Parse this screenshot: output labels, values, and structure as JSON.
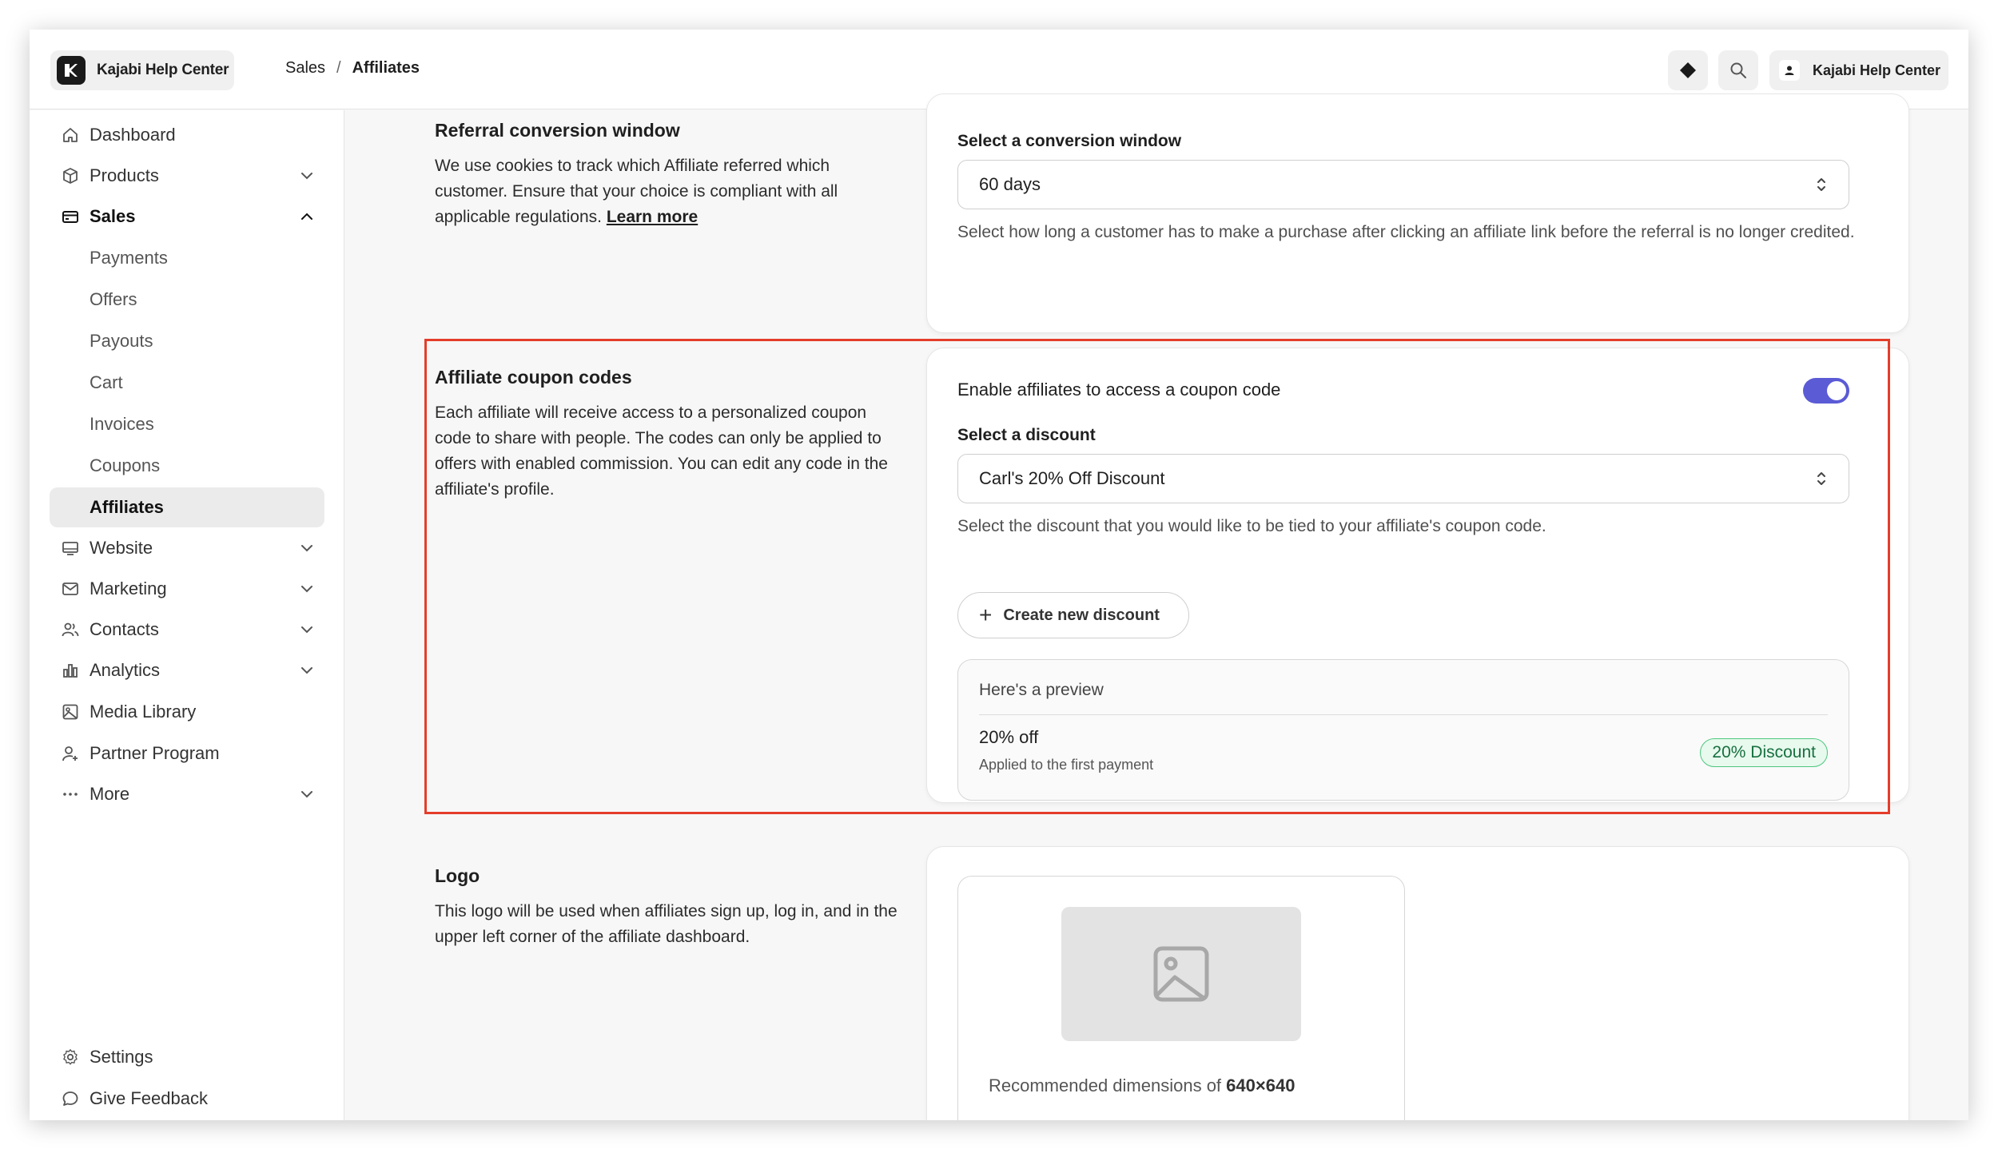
{
  "header": {
    "brand": "Kajabi Help Center",
    "breadcrumb": [
      "Sales",
      "Affiliates"
    ],
    "breadcrumb_sep": "/",
    "user_label": "Kajabi Help Center"
  },
  "sidebar": {
    "items": [
      {
        "label": "Dashboard",
        "icon": "home-icon"
      },
      {
        "label": "Products",
        "icon": "cube-icon"
      },
      {
        "label": "Sales",
        "icon": "credit-card-icon"
      },
      {
        "label": "Website",
        "icon": "monitor-icon"
      },
      {
        "label": "Marketing",
        "icon": "mail-icon"
      },
      {
        "label": "Contacts",
        "icon": "users-icon"
      },
      {
        "label": "Analytics",
        "icon": "bar-chart-icon"
      },
      {
        "label": "Media Library",
        "icon": "image-icon"
      },
      {
        "label": "Partner Program",
        "icon": "partner-icon"
      },
      {
        "label": "More",
        "icon": "more-icon"
      }
    ],
    "sales_sub": [
      "Payments",
      "Offers",
      "Payouts",
      "Cart",
      "Invoices",
      "Coupons",
      "Affiliates"
    ],
    "footer": [
      {
        "label": "Settings",
        "icon": "gear-icon"
      },
      {
        "label": "Give Feedback",
        "icon": "chat-icon"
      }
    ]
  },
  "referral": {
    "title": "Referral conversion window",
    "desc": "We use cookies to track which Affiliate referred which customer. Ensure that your choice is compliant with all applicable regulations.",
    "learn_more": "Learn more",
    "field_label": "Select a conversion window",
    "selected": "60 days",
    "help": "Select how long a customer has to make a purchase after clicking an affiliate link before the referral is no longer credited."
  },
  "coupon": {
    "title": "Affiliate coupon codes",
    "desc": "Each affiliate will receive access to a personalized coupon code to share with people. The codes can only be applied to offers with enabled commission. You can edit any code in the affiliate's profile.",
    "toggle_label": "Enable affiliates to access a coupon code",
    "toggle_on": true,
    "discount_label": "Select a discount",
    "discount_selected": "Carl's 20% Off Discount",
    "help": "Select the discount that you would like to be tied to your affiliate's coupon code.",
    "create_button": "Create new discount",
    "preview": {
      "heading": "Here's a preview",
      "amount": "20% off",
      "subtext": "Applied to the first payment",
      "badge": "20% Discount"
    }
  },
  "logo": {
    "title": "Logo",
    "desc": "This logo will be used when affiliates sign up, log in, and in the upper left corner of the affiliate dashboard.",
    "recommend_prefix": "Recommended dimensions of",
    "recommend_size": "640×640"
  },
  "colors": {
    "accent": "#5b5bd6",
    "highlight": "#e53d2a",
    "badge_green": "#4ec77f"
  }
}
